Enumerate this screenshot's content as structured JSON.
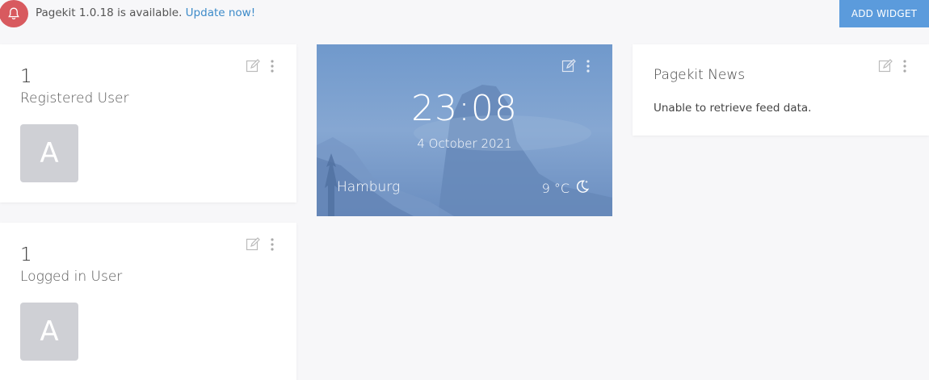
{
  "notice": {
    "message": "Pagekit 1.0.18 is available.",
    "link": "Update now!"
  },
  "toolbar": {
    "add_widget_label": "ADD WIDGET"
  },
  "colors": {
    "accent": "#5b9bdc",
    "alert": "#d85a5f",
    "link": "#3d8bc9",
    "avatar": "#cfd0d5"
  },
  "widgets": {
    "registered": {
      "count": "1",
      "label": "Registered User",
      "avatar_letter": "A"
    },
    "logged_in": {
      "count": "1",
      "label": "Logged in User",
      "avatar_letter": "A"
    },
    "clock": {
      "time": "23:08",
      "date": "4 October 2021",
      "city": "Hamburg",
      "temperature": "9 °C",
      "weather_icon": "moon-icon"
    },
    "news": {
      "title": "Pagekit News",
      "message": "Unable to retrieve feed data."
    }
  },
  "icons": [
    "bell-icon",
    "edit-icon",
    "more-vertical-icon",
    "moon-icon"
  ]
}
